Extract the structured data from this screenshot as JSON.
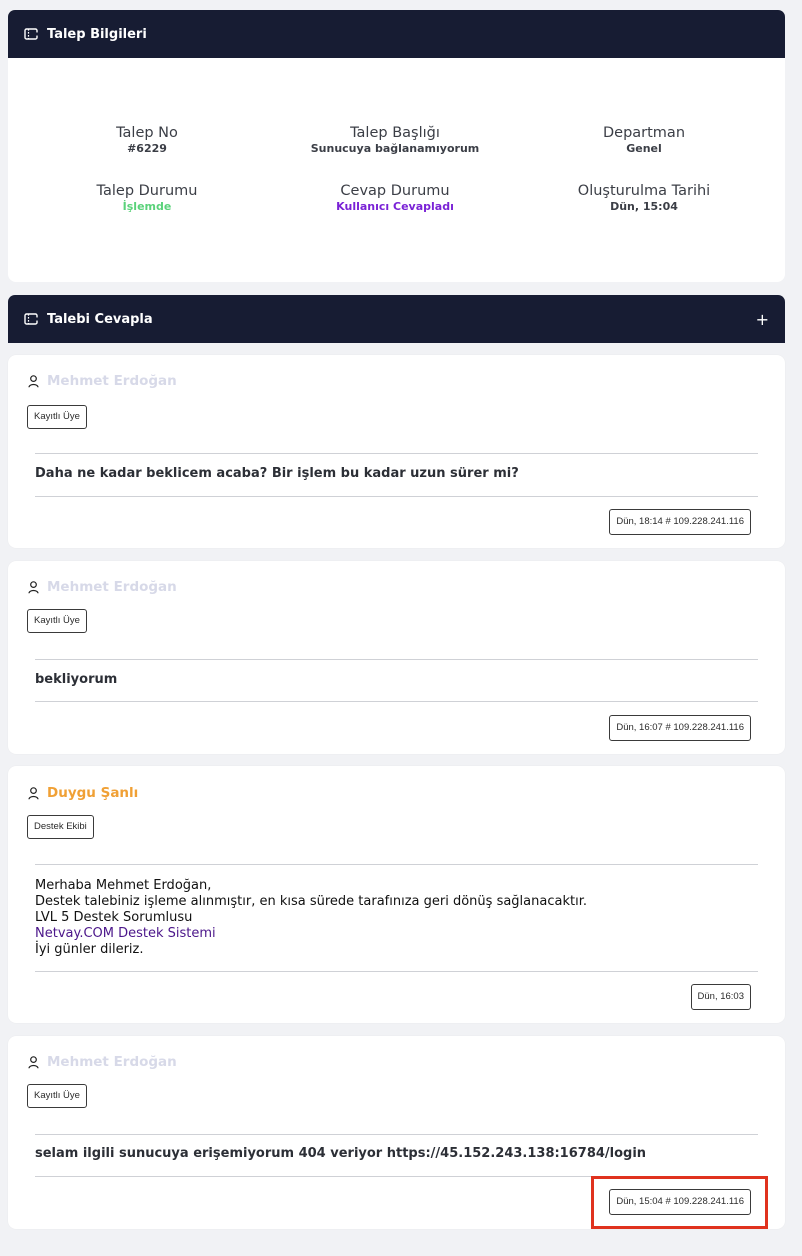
{
  "info_panel": {
    "title": "Talep Bilgileri",
    "fields": {
      "ticket_no": {
        "label": "Talep No",
        "value": "#6229"
      },
      "subject": {
        "label": "Talep Başlığı",
        "value": "Sunucuya bağlanamıyorum"
      },
      "department": {
        "label": "Departman",
        "value": "Genel"
      },
      "status": {
        "label": "Talep Durumu",
        "value": "İşlemde"
      },
      "reply_status": {
        "label": "Cevap Durumu",
        "value": "Kullanıcı Cevapladı"
      },
      "created_at": {
        "label": "Oluşturulma Tarihi",
        "value": "Dün, 15:04"
      }
    }
  },
  "reply_panel": {
    "title": "Talebi Cevapla",
    "toggle": "+"
  },
  "messages": [
    {
      "author": "Mehmet Erdoğan",
      "role": "Kayıtlı Üye",
      "text": "Daha ne kadar beklicem acaba? Bir işlem bu kadar uzun sürer mi?",
      "stamp": "Dün, 18:14 # 109.228.241.116"
    },
    {
      "author": "Mehmet Erdoğan",
      "role": "Kayıtlı Üye",
      "text": "bekliyorum",
      "stamp": "Dün, 16:07 # 109.228.241.116"
    },
    {
      "author": "Duygu Şanlı",
      "role": "Destek Ekibi",
      "lines": [
        "Merhaba Mehmet Erdoğan,",
        "Destek talebiniz işleme alınmıştır, en kısa sürede tarafınıza geri dönüş sağlanacaktır.",
        "LVL 5 Destek Sorumlusu",
        "Netvay.COM Destek Sistemi",
        "İyi günler dileriz."
      ],
      "stamp": "Dün, 16:03"
    },
    {
      "author": "Mehmet Erdoğan",
      "role": "Kayıtlı Üye",
      "text": "selam ilgili sunucuya erişemiyorum 404 veriyor https://45.152.243.138:16784/login",
      "stamp": "Dün, 15:04 # 109.228.241.116"
    }
  ],
  "colors": {
    "header_bg": "#171c33",
    "status_green": "#5ad27a",
    "reply_purple": "#7a22d6",
    "staff_orange": "#f0a035",
    "member_gray": "#d7d9e8",
    "link_purple": "#4b168a",
    "highlight_red": "#e0321e"
  }
}
